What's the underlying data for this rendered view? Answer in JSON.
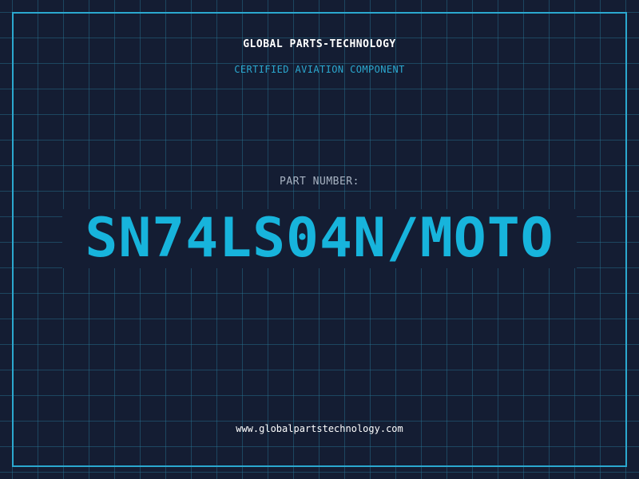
{
  "header": {
    "company": "GLOBAL PARTS-TECHNOLOGY",
    "subtitle": "CERTIFIED AVIATION COMPONENT"
  },
  "part": {
    "label": "PART NUMBER:",
    "number": "SN74LS04N/MOTO"
  },
  "footer": {
    "website": "www.globalpartstechnology.com"
  },
  "colors": {
    "background": "#141d33",
    "accent": "#17b4dc",
    "grid": "#28788f",
    "text": "#ffffff"
  }
}
